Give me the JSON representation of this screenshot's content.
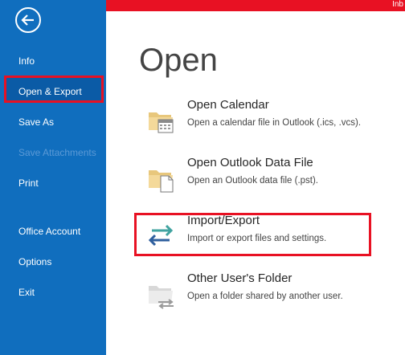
{
  "topbar": {
    "text": "Inb"
  },
  "sidebar": {
    "items": [
      {
        "label": "Info"
      },
      {
        "label": "Open & Export"
      },
      {
        "label": "Save As"
      },
      {
        "label": "Save Attachments"
      },
      {
        "label": "Print"
      },
      {
        "label": "Office Account"
      },
      {
        "label": "Options"
      },
      {
        "label": "Exit"
      }
    ]
  },
  "main": {
    "title": "Open",
    "options": [
      {
        "title": "Open Calendar",
        "description": "Open a calendar file in Outlook (.ics, .vcs).",
        "icon": "calendar-folder-icon"
      },
      {
        "title": "Open Outlook Data File",
        "description": "Open an Outlook data file (.pst).",
        "icon": "data-file-folder-icon"
      },
      {
        "title": "Import/Export",
        "description": "Import or export files and settings.",
        "icon": "import-export-arrows-icon"
      },
      {
        "title": "Other User's Folder",
        "description": "Open a folder shared by another user.",
        "icon": "shared-folder-icon"
      }
    ]
  },
  "colors": {
    "sidebar": "#106ebe",
    "highlight": "#e81123",
    "topbar": "#e81123"
  }
}
